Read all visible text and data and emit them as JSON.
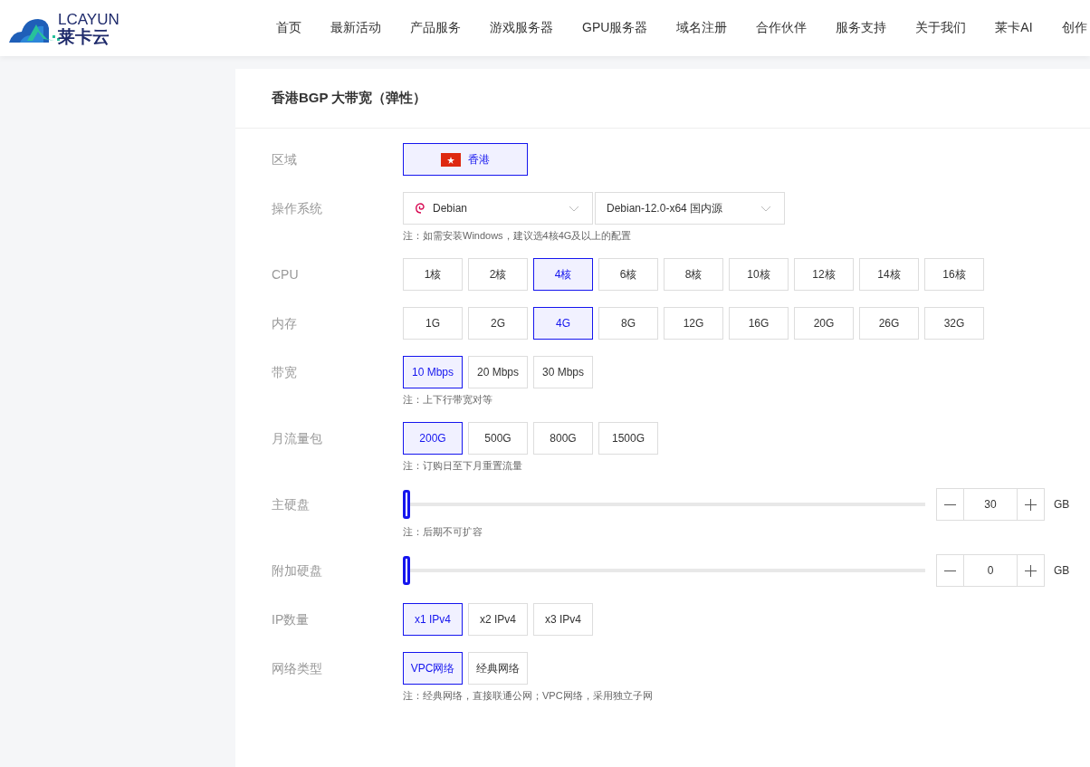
{
  "header": {
    "logo": {
      "latin": "LCAYUN",
      "chinese": "莱卡云"
    },
    "nav": [
      "首页",
      "最新活动",
      "产品服务",
      "游戏服务器",
      "GPU服务器",
      "域名注册",
      "合作伙伴",
      "服务支持",
      "关于我们",
      "莱卡AI",
      "创作"
    ]
  },
  "product": {
    "title": "香港BGP 大带宽（弹性）"
  },
  "form": [
    {
      "kind": "region",
      "label": "区域",
      "options": [
        {
          "label": "香港",
          "selected": true
        }
      ]
    },
    {
      "kind": "select",
      "label": "操作系统",
      "selects": [
        "Debian",
        "Debian-12.0-x64 国内源"
      ],
      "note": "注：如需安装Windows，建议选4核4G及以上的配置"
    },
    {
      "kind": "options",
      "label": "CPU",
      "options": [
        {
          "label": "1核",
          "selected": false
        },
        {
          "label": "2核",
          "selected": false
        },
        {
          "label": "4核",
          "selected": true
        },
        {
          "label": "6核",
          "selected": false
        },
        {
          "label": "8核",
          "selected": false
        },
        {
          "label": "10核",
          "selected": false
        },
        {
          "label": "12核",
          "selected": false
        },
        {
          "label": "14核",
          "selected": false
        },
        {
          "label": "16核",
          "selected": false
        }
      ]
    },
    {
      "kind": "options",
      "label": "内存",
      "options": [
        {
          "label": "1G",
          "selected": false
        },
        {
          "label": "2G",
          "selected": false
        },
        {
          "label": "4G",
          "selected": true
        },
        {
          "label": "8G",
          "selected": false
        },
        {
          "label": "12G",
          "selected": false
        },
        {
          "label": "16G",
          "selected": false
        },
        {
          "label": "20G",
          "selected": false
        },
        {
          "label": "26G",
          "selected": false
        },
        {
          "label": "32G",
          "selected": false
        }
      ]
    },
    {
      "kind": "options",
      "label": "带宽",
      "options": [
        {
          "label": "10 Mbps",
          "selected": true
        },
        {
          "label": "20 Mbps",
          "selected": false
        },
        {
          "label": "30 Mbps",
          "selected": false
        }
      ],
      "note": "注：上下行带宽对等"
    },
    {
      "kind": "options",
      "label": "月流量包",
      "options": [
        {
          "label": "200G",
          "selected": true
        },
        {
          "label": "500G",
          "selected": false
        },
        {
          "label": "800G",
          "selected": false
        },
        {
          "label": "1500G",
          "selected": false
        }
      ],
      "note": "注：订购日至下月重置流量"
    },
    {
      "kind": "slider",
      "label": "主硬盘",
      "level": 0,
      "value": "30",
      "unit": "GB",
      "note": "注：后期不可扩容"
    },
    {
      "kind": "slider",
      "label": "附加硬盘",
      "level": 0,
      "value": "0",
      "unit": "GB"
    },
    {
      "kind": "options",
      "label": "IP数量",
      "options": [
        {
          "label": "x1 IPv4",
          "selected": true
        },
        {
          "label": "x2 IPv4",
          "selected": false
        },
        {
          "label": "x3 IPv4",
          "selected": false
        }
      ]
    },
    {
      "kind": "options",
      "label": "网络类型",
      "options": [
        {
          "label": "VPC网络",
          "selected": true
        },
        {
          "label": "经典网络",
          "selected": false
        }
      ],
      "note": "注：经典网络，直接联通公网；VPC网络，采用独立子网"
    }
  ]
}
